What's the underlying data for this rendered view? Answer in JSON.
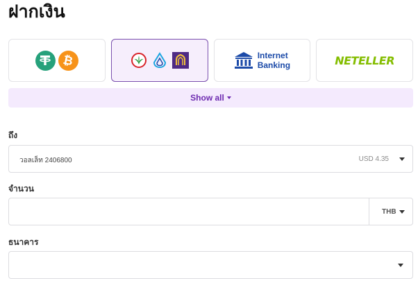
{
  "page": {
    "title": "ฝากเงิน"
  },
  "methods": [
    {
      "name": "crypto",
      "icons": [
        "tether-icon",
        "bitcoin-icon"
      ],
      "selected": false
    },
    {
      "name": "thai-banks",
      "icons": [
        "kasikorn-bank-icon",
        "krungthai-bank-icon",
        "siam-commercial-bank-icon"
      ],
      "selected": true
    },
    {
      "name": "internet-banking",
      "icon": "bank-building-icon",
      "line1": "Internet",
      "line2": "Banking",
      "selected": false
    },
    {
      "name": "neteller",
      "label": "NETELLER",
      "selected": false
    }
  ],
  "show_all": {
    "label": "Show all"
  },
  "to_field": {
    "label": "ถึง",
    "value": "วอลเล็ท 2406800",
    "balance": "USD 4.35"
  },
  "amount_field": {
    "label": "จำนวน",
    "value": "",
    "currency": "THB"
  },
  "bank_field": {
    "label": "ธนาคาร",
    "value": ""
  },
  "colors": {
    "accent": "#6d2bb0",
    "selected_border": "#7a4fae",
    "selected_bg": "#f6eefc",
    "tether": "#26a17b",
    "bitcoin": "#f7931a",
    "kasikorn": "#138f2d",
    "krungthai": "#1ba5e1",
    "scb": "#4e2a84",
    "internet_banking": "#1b4aa8",
    "neteller": "#84bd00"
  }
}
